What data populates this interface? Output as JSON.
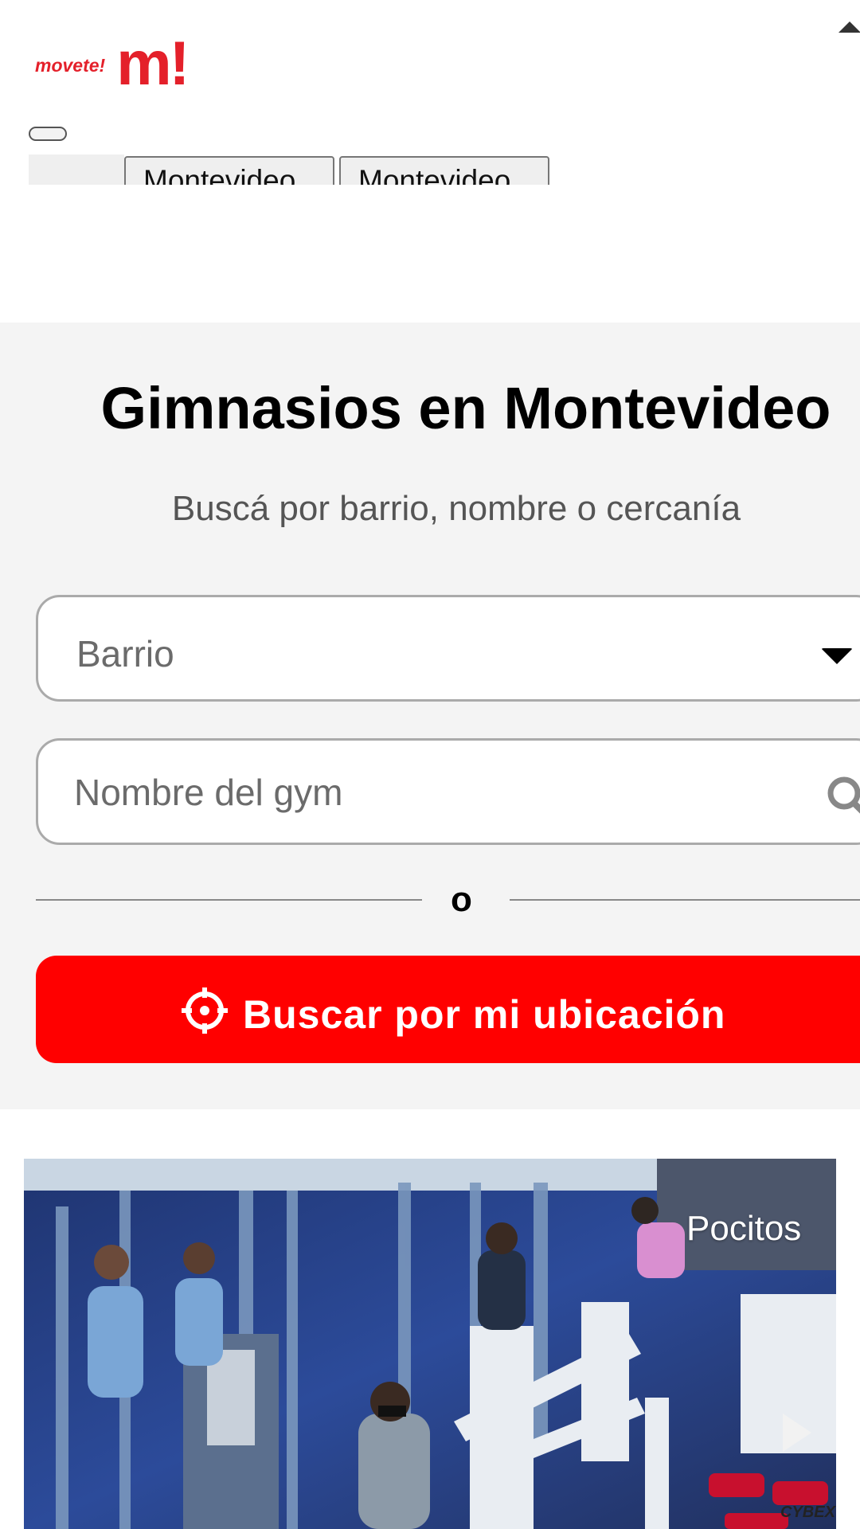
{
  "header": {
    "logo_small": "movete!",
    "logo_big": "m!",
    "tabs": [
      {
        "label": "Montevideo"
      },
      {
        "label": "Montevideo"
      }
    ]
  },
  "search": {
    "title": "Gimnasios en Montevideo",
    "subtitle": "Buscá por barrio, nombre o cercanía",
    "barrio_placeholder": "Barrio",
    "gym_placeholder": "Nombre del gym",
    "divider_text": "o",
    "locate_label": "Buscar por mi ubicación"
  },
  "gym_card": {
    "badge": "Pocitos",
    "photo_brand": "CYBEX"
  },
  "colors": {
    "brand_red": "#e4202a",
    "button_red": "#ff0000",
    "panel_bg": "#f4f4f4"
  }
}
